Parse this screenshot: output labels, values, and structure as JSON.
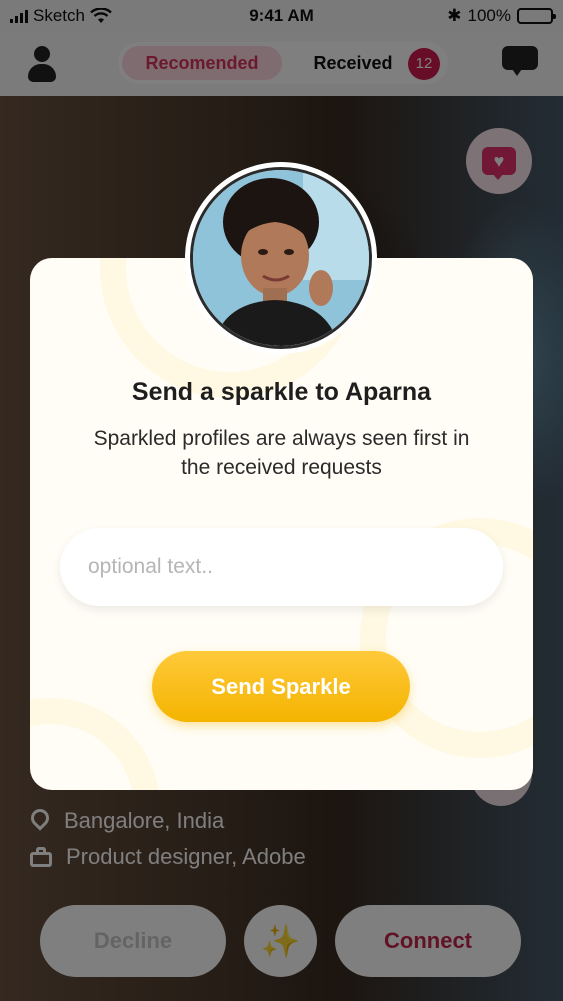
{
  "status_bar": {
    "carrier": "Sketch",
    "time": "9:41 AM",
    "battery": "100%"
  },
  "nav": {
    "tab_recommended": "Recomended",
    "tab_received": "Received",
    "received_count": "12"
  },
  "profile": {
    "location": "Bangalore, India",
    "job": "Product designer, Adobe"
  },
  "actions": {
    "decline": "Decline",
    "connect": "Connect",
    "sparkle_icon": "✨"
  },
  "modal": {
    "title": "Send a sparkle to Aparna",
    "subtitle": "Sparkled profiles are always seen first in the received requests",
    "input_placeholder": "optional text..",
    "send_label": "Send Sparkle"
  },
  "colors": {
    "accent_pink": "#d11b4f",
    "accent_gold": "#f4b400"
  }
}
